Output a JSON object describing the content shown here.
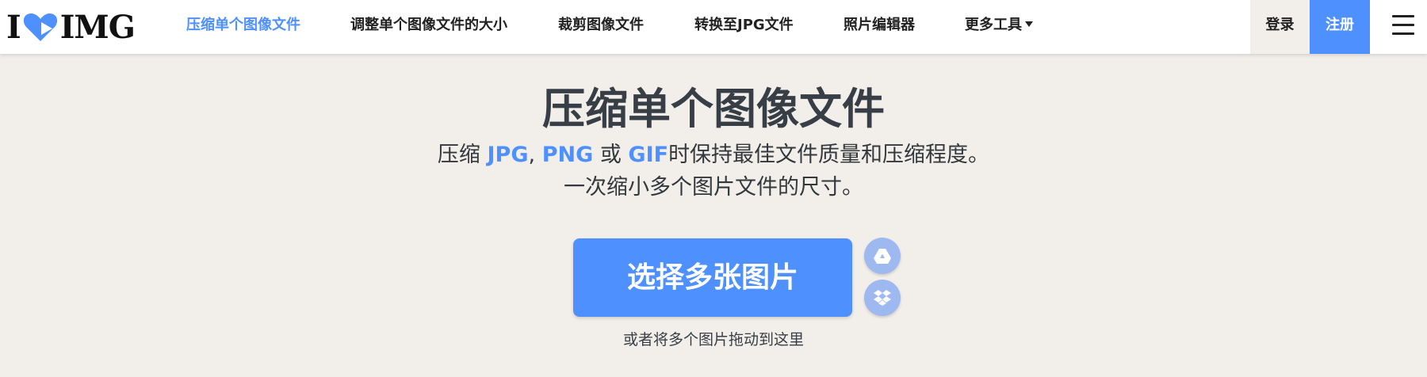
{
  "brand": {
    "logo_left": "I",
    "logo_right": "IMG",
    "accent_color": "#4d90fe"
  },
  "nav": {
    "items": [
      {
        "label": "压缩单个图像文件",
        "active": true
      },
      {
        "label": "调整单个图像文件的大小"
      },
      {
        "label": "裁剪图像文件"
      },
      {
        "label": "转换至JPG文件"
      },
      {
        "label": "照片编辑器"
      },
      {
        "label": "更多工具"
      }
    ],
    "login": "登录",
    "signup": "注册"
  },
  "main": {
    "title": "压缩单个图像文件",
    "subtitle_line1": {
      "prefix": "压缩 ",
      "fmt1": "JPG",
      "sep": ", ",
      "fmt2": "PNG",
      "mid": " 或 ",
      "fmt3": "GIF",
      "suffix": "时保持最佳文件质量和压缩程度。"
    },
    "subtitle_line2": "一次缩小多个图片文件的尺寸。",
    "select_button": "选择多张图片",
    "drop_hint": "或者将多个图片拖动到这里"
  },
  "icons": {
    "heart": "heart-icon",
    "menu": "hamburger-menu-icon",
    "gdrive": "google-drive-icon",
    "dropbox": "dropbox-icon",
    "caret": "caret-down-icon"
  }
}
